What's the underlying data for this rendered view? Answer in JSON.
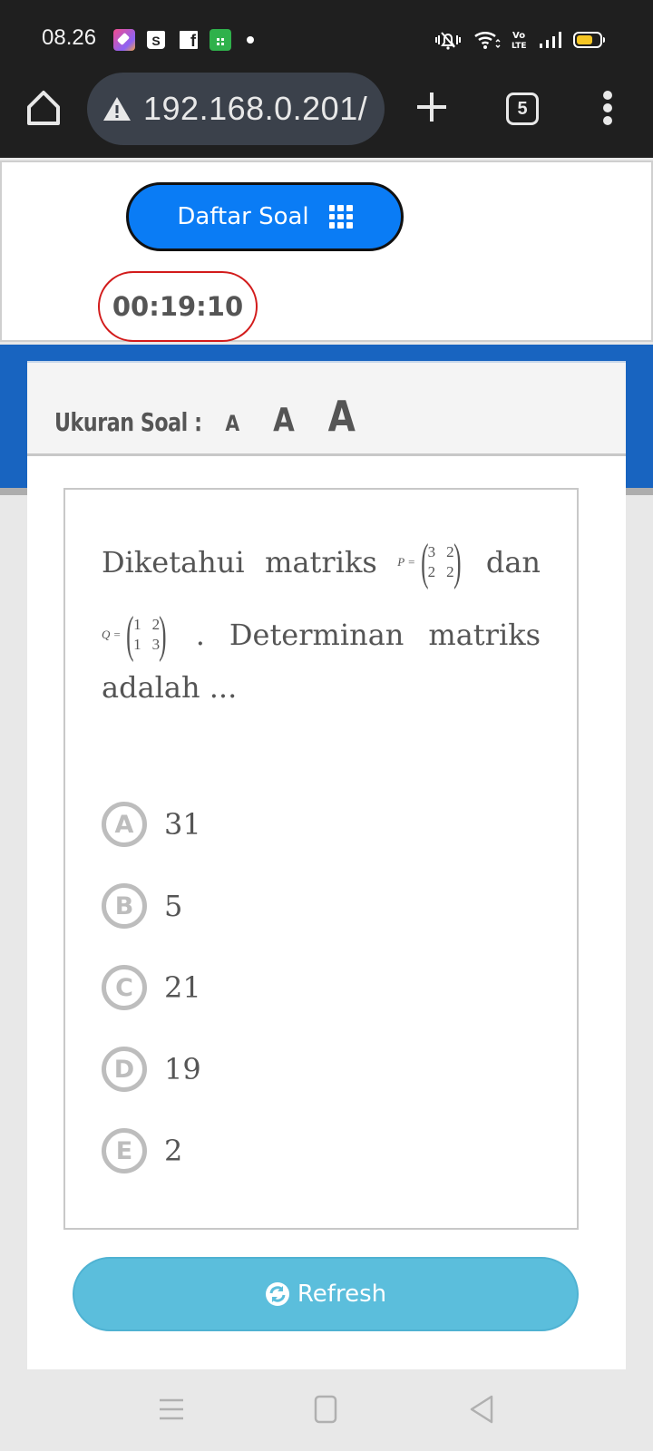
{
  "status_bar": {
    "time": "08.26",
    "notification_icons": [
      "paintbrush-app-icon",
      "shopee-icon",
      "facebook-icon",
      "green-shopping-bag-icon",
      "more-notifications-dot"
    ],
    "system_icons": [
      "vibrate-mute-icon",
      "wifi-icon",
      "volte-icon",
      "signal-icon",
      "battery-icon"
    ],
    "volte_label_top": "Vo",
    "volte_label_bottom": "LTE",
    "battery_color": "#f6c624"
  },
  "browser": {
    "url": "192.168.0.201/",
    "tab_count": "5"
  },
  "header": {
    "daftar_soal_label": "Daftar Soal",
    "timer": "00:19:10"
  },
  "font_size_bar": {
    "label": "Ukuran Soal :",
    "small": "A",
    "medium": "A",
    "large": "A"
  },
  "question": {
    "line1_text": "Diketahui",
    "line1_word2": "matriks",
    "line1_after": "dan",
    "matrix_p": {
      "name": "P =",
      "cells": [
        "3",
        "2",
        "2",
        "2"
      ]
    },
    "matrix_q": {
      "name": "Q =",
      "cells": [
        "1",
        "2",
        "1",
        "3"
      ]
    },
    "line2_dot": ".",
    "line2_word1": "Determinan",
    "line2_word2": "matriks",
    "line3_text": "adalah ..."
  },
  "options": [
    {
      "letter": "A",
      "text": "31"
    },
    {
      "letter": "B",
      "text": "5"
    },
    {
      "letter": "C",
      "text": "21"
    },
    {
      "letter": "D",
      "text": "19"
    },
    {
      "letter": "E",
      "text": "2"
    }
  ],
  "refresh_label": "Refresh",
  "colors": {
    "primary_button": "#0a7cf5",
    "timer_border": "#d21b1b",
    "blue_band": "#1864c0",
    "refresh_button": "#5bbedc"
  }
}
